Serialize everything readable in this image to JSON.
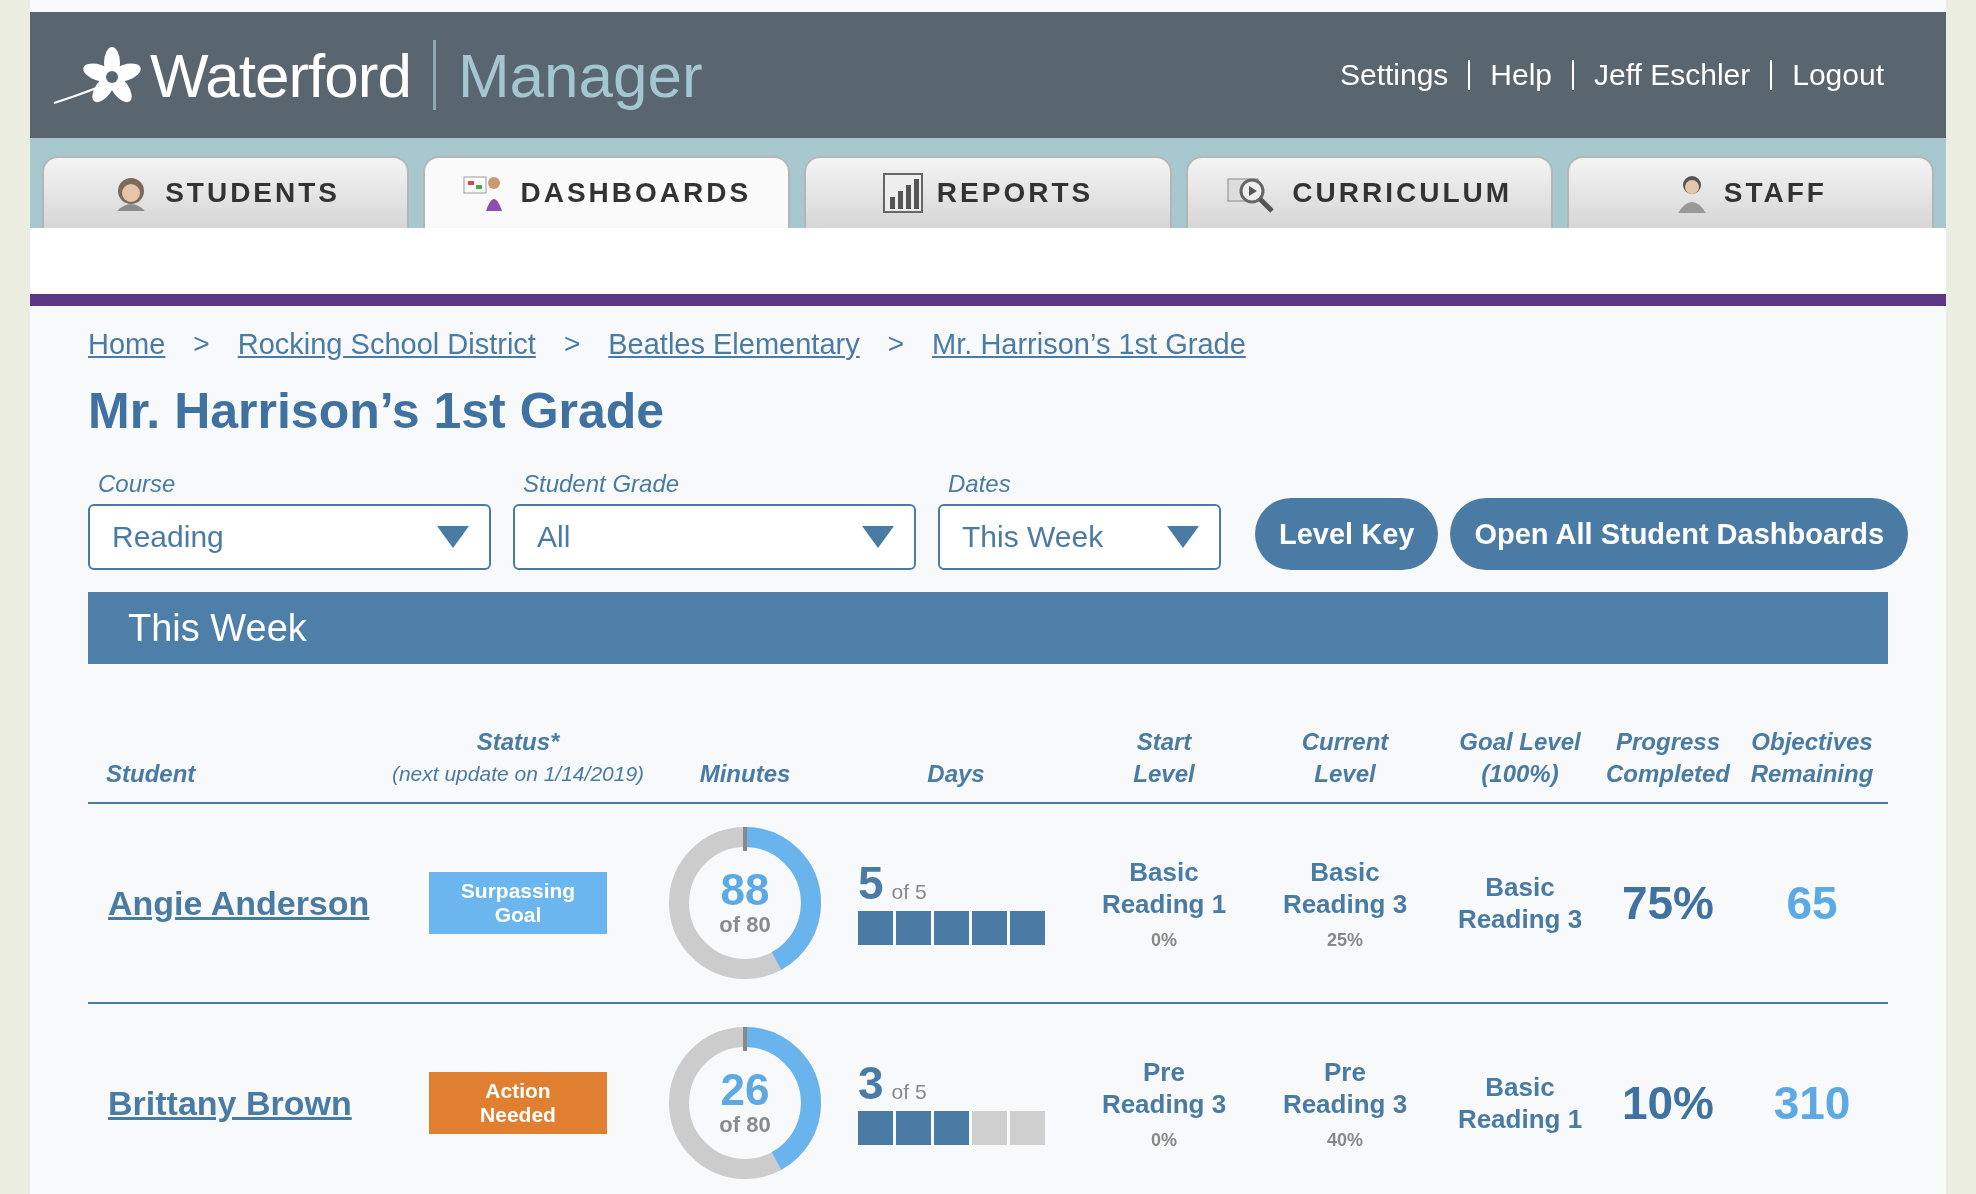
{
  "header": {
    "brand": "Waterford",
    "product": "Manager",
    "links": [
      "Settings",
      "Help",
      "Jeff Eschler",
      "Logout"
    ]
  },
  "tabs": [
    {
      "label": "STUDENTS",
      "kind": "student",
      "selected": false
    },
    {
      "label": "DASHBOARDS",
      "kind": "dashboard",
      "selected": true
    },
    {
      "label": "REPORTS",
      "kind": "chart",
      "selected": false
    },
    {
      "label": "CURRICULUM",
      "kind": "video",
      "selected": false
    },
    {
      "label": "STAFF",
      "kind": "staff",
      "selected": false
    }
  ],
  "breadcrumbs": {
    "separator": ">",
    "items": [
      "Home",
      "Rocking School District",
      "Beatles Elementary",
      "Mr. Harrison’s 1st Grade"
    ]
  },
  "title": "Mr. Harrison’s 1st Grade",
  "filters": [
    {
      "label": "Course",
      "value": "Reading"
    },
    {
      "label": "Student Grade",
      "value": "All"
    },
    {
      "label": "Dates",
      "value": "This Week"
    }
  ],
  "buttons": [
    "Level Key",
    "Open All Student Dashboards"
  ],
  "period_banner": "This Week",
  "table": {
    "columns": [
      {
        "lines": [
          "Student"
        ]
      },
      {
        "lines": [
          "Status*",
          "(next update on 1/14/2019)"
        ]
      },
      {
        "lines": [
          "Minutes"
        ]
      },
      {
        "lines": [
          "Days"
        ]
      },
      {
        "lines": [
          "Start",
          "Level"
        ]
      },
      {
        "lines": [
          "Current",
          "Level"
        ]
      },
      {
        "lines": [
          "Goal Level",
          "(100%)"
        ]
      },
      {
        "lines": [
          "Progress",
          "Completed"
        ]
      },
      {
        "lines": [
          "Objectives",
          "Remaining"
        ]
      }
    ],
    "rows": [
      {
        "student": "Angie Anderson",
        "status": "Surpassing Goal",
        "color": "#6cb6ef",
        "minutes": "88",
        "minutes_goal": "of 80",
        "level": 0.42,
        "days": "5",
        "days_total": "of 5",
        "day_blocks": [
          {
            "filled": true
          },
          {
            "filled": true
          },
          {
            "filled": true
          },
          {
            "filled": true
          },
          {
            "filled": true
          }
        ],
        "start_level": "Basic Reading 1",
        "start_pct": "0%",
        "current_level": "Basic Reading 3",
        "current_pct": "25%",
        "goal_level": "Basic Reading 3",
        "progress": "75%",
        "objectives": "65"
      },
      {
        "student": "Brittany Brown",
        "status": "Action Needed",
        "color": "#e07f30",
        "minutes": "26",
        "minutes_goal": "of 80",
        "level": 0.42,
        "days": "3",
        "days_total": "of 5",
        "day_blocks": [
          {
            "filled": true
          },
          {
            "filled": true
          },
          {
            "filled": true
          },
          {
            "filled": false
          },
          {
            "filled": false
          }
        ],
        "start_level": "Pre Reading 3",
        "start_pct": "0%",
        "current_level": "Pre Reading 3",
        "current_pct": "40%",
        "goal_level": "Basic Reading 1",
        "progress": "10%",
        "objectives": "310"
      }
    ]
  }
}
